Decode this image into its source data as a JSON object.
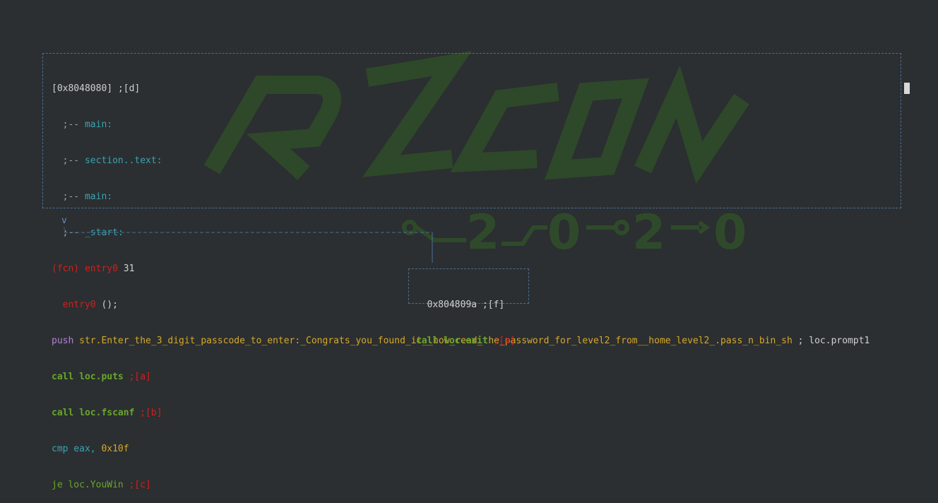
{
  "watermark": {
    "logo_text": "RZCON",
    "year_text": "2020"
  },
  "main_node": {
    "address": "[0x8048080] ;[d]",
    "labels": [
      ";-- main:",
      ";-- section..text:",
      ";-- main:",
      ";-- _start:"
    ],
    "label_prefix": ";-- ",
    "label_names": [
      "main:",
      "section..text:",
      "main:",
      "_start:"
    ],
    "fcn_tag": "(fcn)",
    "fcn_name": "entry0",
    "fcn_size": "31",
    "fcn_sig_name": "entry0",
    "fcn_sig_rest": " ();",
    "push_mnemonic": "push",
    "push_operand": "str.Enter_the_3_digit_passcode_to_enter:_Congrats_you_found_it__now_read_the_password_for_level2_from__home_level2_.pass_n_bin_sh",
    "push_comment": "; loc.prompt1",
    "call1_text": "call loc.puts",
    "call1_ref": ";[a]",
    "call2_text": "call loc.fscanf",
    "call2_ref": ";[b]",
    "cmp_mnemonic": "cmp eax,",
    "cmp_operand": "0x10f",
    "je_text": "je loc.YouWin",
    "je_ref": ";[c]"
  },
  "edge": {
    "label": "v"
  },
  "exit_node": {
    "address": "0x804809a ;[f]",
    "call_text": "call loc.exit",
    "call_ref": ";[e]"
  },
  "colors": {
    "background": "#2b2f31",
    "border": "#4d6e93",
    "green": "#69a62b",
    "red": "#d11f1f",
    "cyan": "#3aa3b3",
    "yellow": "#d7a82a",
    "purple": "#b57edb",
    "watermark": "#2f4a2a"
  }
}
